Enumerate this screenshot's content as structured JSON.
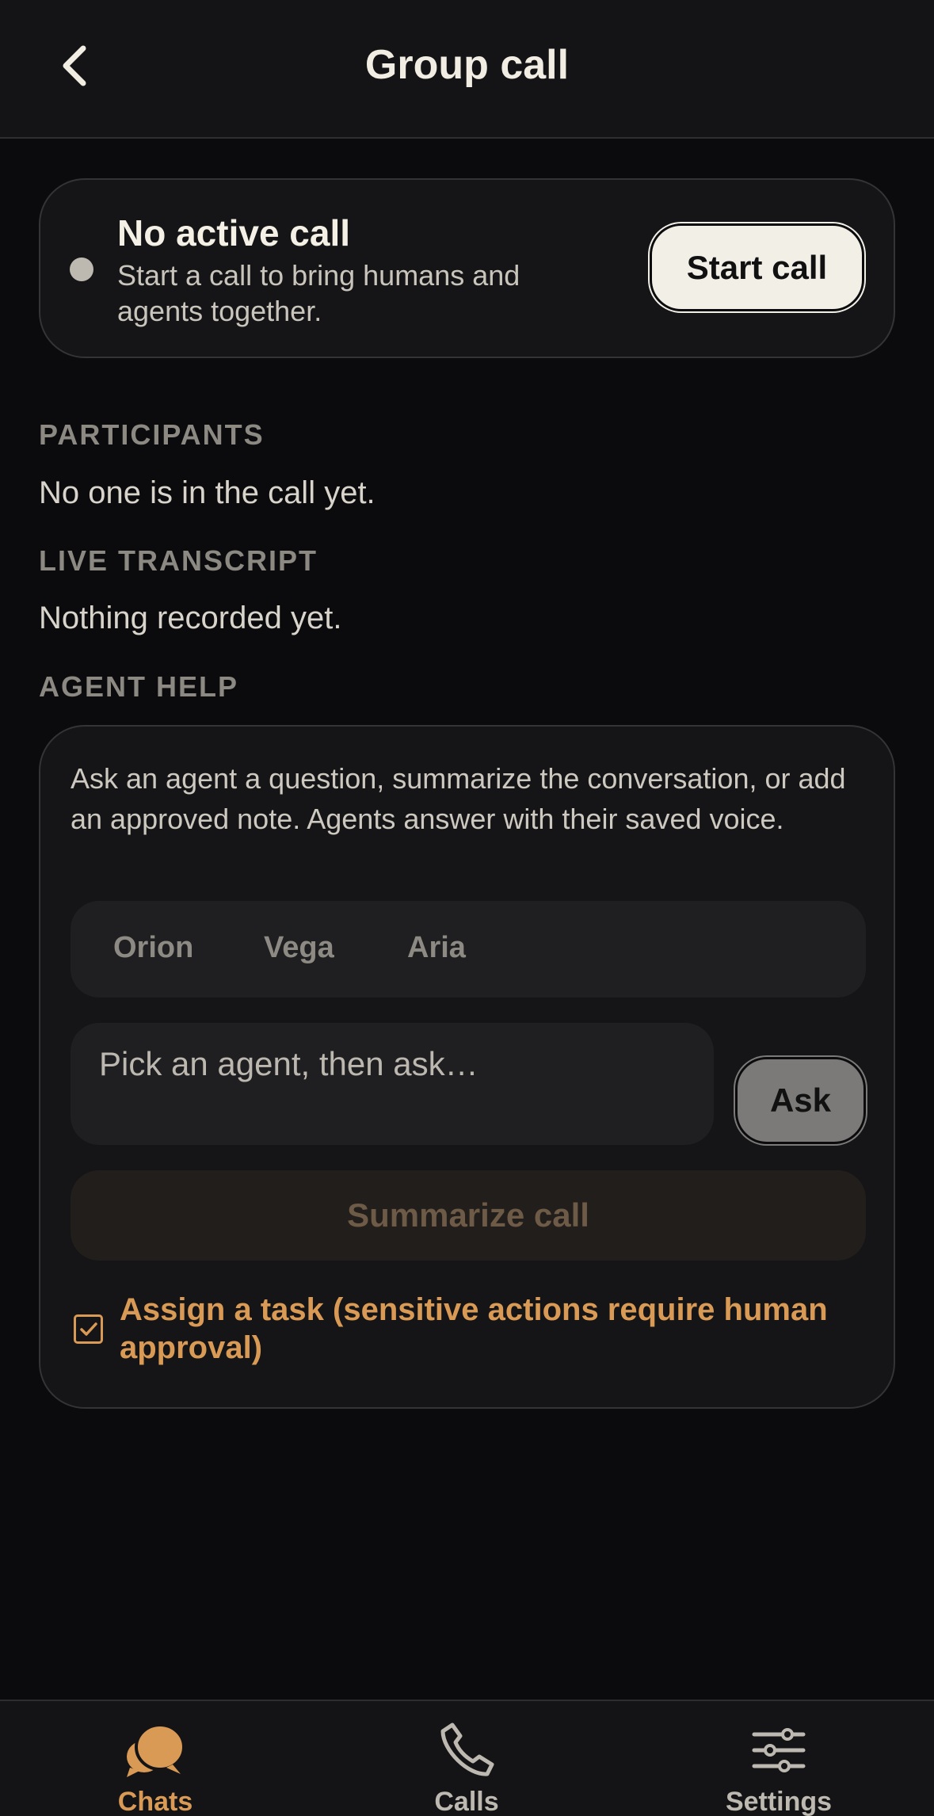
{
  "header": {
    "title": "Group call",
    "back_icon": "chevron-left-icon"
  },
  "call_status": {
    "title": "No active call",
    "subtitle": "Start a call to bring humans and agents together.",
    "start_label": "Start call",
    "status_color": "#bdb9b1"
  },
  "participants": {
    "label": "PARTICIPANTS",
    "empty_text": "No one is in the call yet."
  },
  "transcript": {
    "label": "LIVE TRANSCRIPT",
    "empty_text": "Nothing recorded yet."
  },
  "agent_help": {
    "label": "AGENT HELP",
    "description": "Ask an agent a question, summarize the conversation, or add an approved note. Agents answer with their saved voice.",
    "agents": [
      "Orion",
      "Vega",
      "Aria"
    ],
    "input_placeholder": "Pick an agent, then ask…",
    "ask_label": "Ask",
    "summarize_label": "Summarize call",
    "task_label": "Assign a task (sensitive actions require human approval)",
    "task_checked": true
  },
  "bottom_nav": {
    "items": [
      {
        "label": "Chats",
        "icon": "chat-bubbles-icon",
        "active": true
      },
      {
        "label": "Calls",
        "icon": "phone-icon",
        "active": false
      },
      {
        "label": "Settings",
        "icon": "sliders-icon",
        "active": false
      }
    ]
  },
  "colors": {
    "accent": "#d99a55",
    "background": "#0b0b0d",
    "surface": "#151517",
    "inactive": "#8d8983"
  }
}
